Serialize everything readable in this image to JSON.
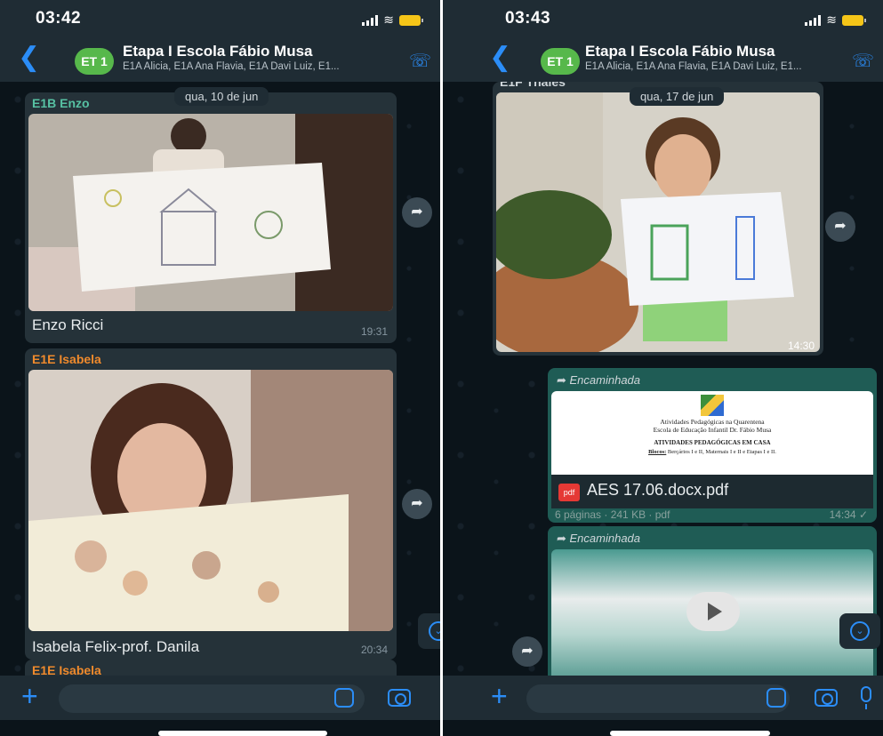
{
  "left": {
    "status": {
      "time": "03:42"
    },
    "header": {
      "avatar": "ET 1",
      "title": "Etapa I Escola Fábio Musa",
      "subtitle": "E1A Alicia, E1A Ana Flavia, E1A Davi Luiz, E1..."
    },
    "date_chip": "qua, 10 de jun",
    "messages": [
      {
        "sender": "E1B Enzo",
        "caption": "Enzo Ricci",
        "time": "19:31"
      },
      {
        "sender": "E1E Isabela",
        "caption": "Isabela Felix-prof. Danila",
        "time": "20:34"
      },
      {
        "sender": "E1E Isabela"
      }
    ]
  },
  "right": {
    "status": {
      "time": "03:43"
    },
    "header": {
      "avatar": "ET 1",
      "title": "Etapa I Escola Fábio Musa",
      "subtitle": "E1A Alicia, E1A Ana Flavia, E1A Davi Luiz, E1..."
    },
    "date_chip": "qua, 17 de jun",
    "photo_message": {
      "sender": "E1F Thales",
      "time": "14:30"
    },
    "doc_message": {
      "forwarded": "Encaminhada",
      "doc_line1": "Atividades Pedagógicas na Quarentena",
      "doc_line2": "Escola de Educação Infantil Dr. Fábio Musa",
      "doc_heading": "ATIVIDADES PEDAGÓGICAS EM CASA",
      "doc_blocos_label": "Blocos:",
      "doc_blocos": " Berçários I e II, Maternais I e II e Etapas I e II.",
      "pdf_badge": "pdf",
      "file_name": "AES 17.06.docx.pdf",
      "file_meta": "6 páginas · 241 KB · pdf",
      "time": "14:34"
    },
    "video_message": {
      "forwarded": "Encaminhada"
    }
  },
  "colors": {
    "accent": "#2b8df7",
    "bubble": "#253239",
    "background": "#0b141a",
    "sender_green": "#57c1a3",
    "sender_orange": "#f08a2c",
    "avatar_green": "#57b84b"
  },
  "icons": [
    "back-icon",
    "call-add-icon",
    "forward-icon",
    "chevron-down-icon",
    "plus-icon",
    "sticker-icon",
    "camera-icon",
    "mic-icon",
    "play-icon",
    "pdf-icon"
  ]
}
